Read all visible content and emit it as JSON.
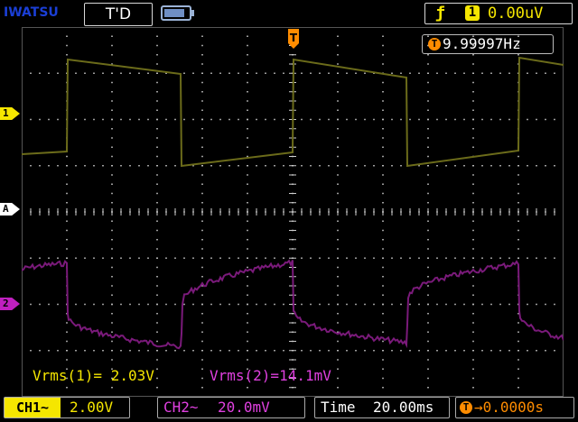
{
  "header": {
    "brand": "IWATSU",
    "mode": "T'D",
    "battery_icon": "battery-icon",
    "battery_level": 0.85,
    "trigger_slope_icon": "rising-edge-icon",
    "trigger_source": "1",
    "trigger_level": "0.00uV"
  },
  "markers": {
    "ch1": "1",
    "ch2": "2",
    "math": "A",
    "trigger": "T"
  },
  "frequency": {
    "icon": "T",
    "value": "9.99997Hz"
  },
  "measurements": {
    "vrms1": "Vrms(1)= 2.03V",
    "vrms2": "Vrms(2)=14.1mV"
  },
  "footer": {
    "ch1_label": "CH1~",
    "ch1_scale": "2.00V",
    "ch2_label": "CH2~",
    "ch2_scale": "20.0mV",
    "time_label": "Time",
    "time_scale": "20.00ms",
    "pos_icon": "T",
    "position": "→0.0000s"
  },
  "colors": {
    "ch1": "#f5e600",
    "ch1_trace": "#6b6b1a",
    "ch2": "#e040e0",
    "ch2_trace": "#7a1a7a",
    "grid": "#d0d0d0",
    "trigger": "#ff8c00",
    "brand": "#1b3fd6"
  }
}
